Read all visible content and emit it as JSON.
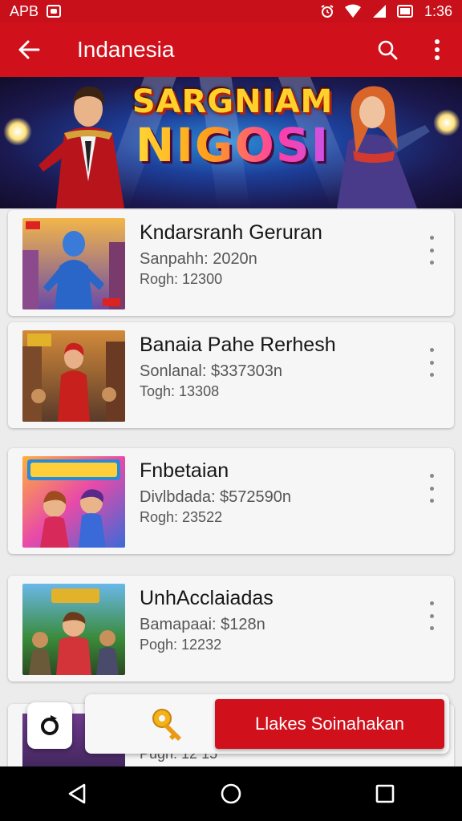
{
  "status_bar": {
    "left_text": "APB",
    "time": "1:36"
  },
  "app_bar": {
    "title": "Indanesia",
    "back_icon": "arrow-left-icon",
    "search_icon": "search-icon",
    "more_icon": "more-vert-icon"
  },
  "banner": {
    "title_line1": "SARGNIAM",
    "title_line2": "NIGOSI"
  },
  "items": [
    {
      "title": "Kndarsranh Geruran",
      "line1": "Sanpahh: 2020n",
      "line2": "Rogh: 12300"
    },
    {
      "title": "Banaia Pahe Rerhesh",
      "line1": "Sonlanal: $337303n",
      "line2": "Togh: 13308"
    },
    {
      "title": "Fnbetaian",
      "line1": "Divlbdada: $572590n",
      "line2": "Rogh: 23522"
    },
    {
      "title": "UnhAcclaiadas",
      "line1": "Bamapaai: $128n",
      "line2": "Pogh: 12232"
    }
  ],
  "partial_item": {
    "line2": "Pugh: 12 15"
  },
  "action_bar": {
    "cta_label": "Llakes Soinahakan"
  },
  "colors": {
    "primary": "#d0111b",
    "status": "#c8101a",
    "nav": "#000000"
  }
}
